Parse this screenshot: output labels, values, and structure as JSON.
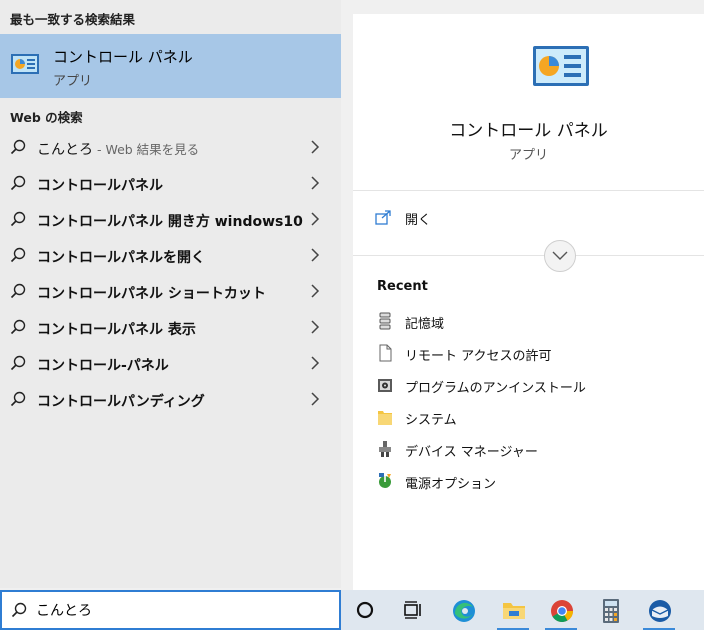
{
  "best_match": {
    "header": "最も一致する検索結果",
    "title": "コントロール パネル",
    "subtitle": "アプリ"
  },
  "web": {
    "header": "Web の検索",
    "suggestions": [
      {
        "text": "こんとろ",
        "hint": " - Web 結果を見る"
      },
      {
        "text": "コントロールパネル"
      },
      {
        "text": "コントロールパネル 開き方 windows10"
      },
      {
        "text": "コントロールパネルを開く"
      },
      {
        "text": "コントロールパネル ショートカット"
      },
      {
        "text": "コントロールパネル 表示"
      },
      {
        "text": "コントロール-パネル"
      },
      {
        "text": "コントロールパンディング"
      }
    ]
  },
  "preview": {
    "title": "コントロール パネル",
    "subtitle": "アプリ",
    "open_label": "開く",
    "recent_header": "Recent",
    "recent": [
      {
        "label": "記憶域",
        "icon": "storage-icon"
      },
      {
        "label": "リモート アクセスの許可",
        "icon": "document-icon"
      },
      {
        "label": "プログラムのアンインストール",
        "icon": "programs-icon"
      },
      {
        "label": "システム",
        "icon": "folder-icon"
      },
      {
        "label": "デバイス マネージャー",
        "icon": "device-manager-icon"
      },
      {
        "label": "電源オプション",
        "icon": "power-options-icon"
      }
    ]
  },
  "search": {
    "value": "こんとろ"
  },
  "taskbar": {
    "icons": [
      "cortana-icon",
      "task-view-icon",
      "edge-icon",
      "file-explorer-icon",
      "chrome-icon",
      "calculator-icon",
      "thunderbird-icon"
    ]
  },
  "colors": {
    "highlight": "#a7c7e7",
    "accent": "#2f7dd3"
  }
}
